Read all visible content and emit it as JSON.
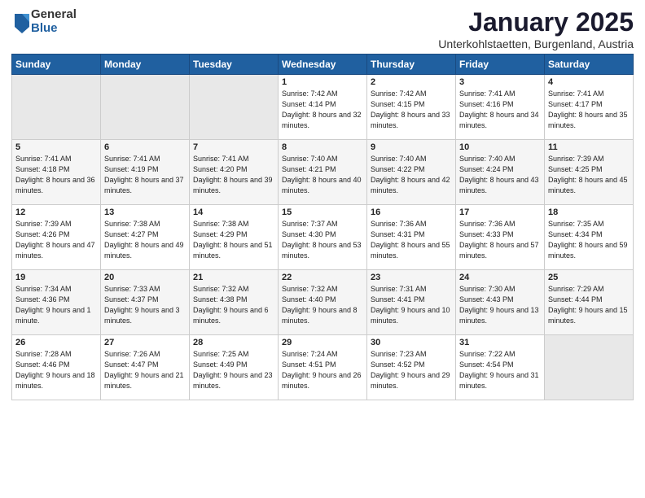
{
  "logo": {
    "general": "General",
    "blue": "Blue"
  },
  "title": "January 2025",
  "subtitle": "Unterkohlstaetten, Burgenland, Austria",
  "days_of_week": [
    "Sunday",
    "Monday",
    "Tuesday",
    "Wednesday",
    "Thursday",
    "Friday",
    "Saturday"
  ],
  "weeks": [
    [
      {
        "day": "",
        "info": ""
      },
      {
        "day": "",
        "info": ""
      },
      {
        "day": "",
        "info": ""
      },
      {
        "day": "1",
        "info": "Sunrise: 7:42 AM\nSunset: 4:14 PM\nDaylight: 8 hours and 32 minutes."
      },
      {
        "day": "2",
        "info": "Sunrise: 7:42 AM\nSunset: 4:15 PM\nDaylight: 8 hours and 33 minutes."
      },
      {
        "day": "3",
        "info": "Sunrise: 7:41 AM\nSunset: 4:16 PM\nDaylight: 8 hours and 34 minutes."
      },
      {
        "day": "4",
        "info": "Sunrise: 7:41 AM\nSunset: 4:17 PM\nDaylight: 8 hours and 35 minutes."
      }
    ],
    [
      {
        "day": "5",
        "info": "Sunrise: 7:41 AM\nSunset: 4:18 PM\nDaylight: 8 hours and 36 minutes."
      },
      {
        "day": "6",
        "info": "Sunrise: 7:41 AM\nSunset: 4:19 PM\nDaylight: 8 hours and 37 minutes."
      },
      {
        "day": "7",
        "info": "Sunrise: 7:41 AM\nSunset: 4:20 PM\nDaylight: 8 hours and 39 minutes."
      },
      {
        "day": "8",
        "info": "Sunrise: 7:40 AM\nSunset: 4:21 PM\nDaylight: 8 hours and 40 minutes."
      },
      {
        "day": "9",
        "info": "Sunrise: 7:40 AM\nSunset: 4:22 PM\nDaylight: 8 hours and 42 minutes."
      },
      {
        "day": "10",
        "info": "Sunrise: 7:40 AM\nSunset: 4:24 PM\nDaylight: 8 hours and 43 minutes."
      },
      {
        "day": "11",
        "info": "Sunrise: 7:39 AM\nSunset: 4:25 PM\nDaylight: 8 hours and 45 minutes."
      }
    ],
    [
      {
        "day": "12",
        "info": "Sunrise: 7:39 AM\nSunset: 4:26 PM\nDaylight: 8 hours and 47 minutes."
      },
      {
        "day": "13",
        "info": "Sunrise: 7:38 AM\nSunset: 4:27 PM\nDaylight: 8 hours and 49 minutes."
      },
      {
        "day": "14",
        "info": "Sunrise: 7:38 AM\nSunset: 4:29 PM\nDaylight: 8 hours and 51 minutes."
      },
      {
        "day": "15",
        "info": "Sunrise: 7:37 AM\nSunset: 4:30 PM\nDaylight: 8 hours and 53 minutes."
      },
      {
        "day": "16",
        "info": "Sunrise: 7:36 AM\nSunset: 4:31 PM\nDaylight: 8 hours and 55 minutes."
      },
      {
        "day": "17",
        "info": "Sunrise: 7:36 AM\nSunset: 4:33 PM\nDaylight: 8 hours and 57 minutes."
      },
      {
        "day": "18",
        "info": "Sunrise: 7:35 AM\nSunset: 4:34 PM\nDaylight: 8 hours and 59 minutes."
      }
    ],
    [
      {
        "day": "19",
        "info": "Sunrise: 7:34 AM\nSunset: 4:36 PM\nDaylight: 9 hours and 1 minute."
      },
      {
        "day": "20",
        "info": "Sunrise: 7:33 AM\nSunset: 4:37 PM\nDaylight: 9 hours and 3 minutes."
      },
      {
        "day": "21",
        "info": "Sunrise: 7:32 AM\nSunset: 4:38 PM\nDaylight: 9 hours and 6 minutes."
      },
      {
        "day": "22",
        "info": "Sunrise: 7:32 AM\nSunset: 4:40 PM\nDaylight: 9 hours and 8 minutes."
      },
      {
        "day": "23",
        "info": "Sunrise: 7:31 AM\nSunset: 4:41 PM\nDaylight: 9 hours and 10 minutes."
      },
      {
        "day": "24",
        "info": "Sunrise: 7:30 AM\nSunset: 4:43 PM\nDaylight: 9 hours and 13 minutes."
      },
      {
        "day": "25",
        "info": "Sunrise: 7:29 AM\nSunset: 4:44 PM\nDaylight: 9 hours and 15 minutes."
      }
    ],
    [
      {
        "day": "26",
        "info": "Sunrise: 7:28 AM\nSunset: 4:46 PM\nDaylight: 9 hours and 18 minutes."
      },
      {
        "day": "27",
        "info": "Sunrise: 7:26 AM\nSunset: 4:47 PM\nDaylight: 9 hours and 21 minutes."
      },
      {
        "day": "28",
        "info": "Sunrise: 7:25 AM\nSunset: 4:49 PM\nDaylight: 9 hours and 23 minutes."
      },
      {
        "day": "29",
        "info": "Sunrise: 7:24 AM\nSunset: 4:51 PM\nDaylight: 9 hours and 26 minutes."
      },
      {
        "day": "30",
        "info": "Sunrise: 7:23 AM\nSunset: 4:52 PM\nDaylight: 9 hours and 29 minutes."
      },
      {
        "day": "31",
        "info": "Sunrise: 7:22 AM\nSunset: 4:54 PM\nDaylight: 9 hours and 31 minutes."
      },
      {
        "day": "",
        "info": ""
      }
    ]
  ]
}
